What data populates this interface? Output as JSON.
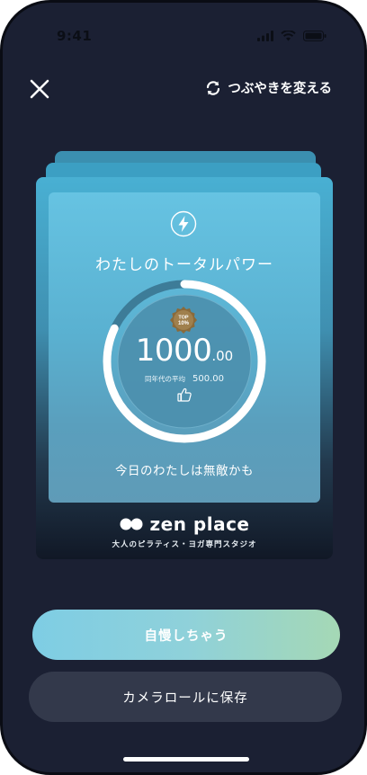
{
  "status_bar": {
    "time": "9:41"
  },
  "header": {
    "change_label": "つぶやきを変える"
  },
  "card": {
    "title": "わたしのトータルパワー",
    "badge": {
      "line1": "TOP",
      "line2": "10%"
    },
    "score_main": "1000",
    "score_decimal": ".00",
    "average_label": "同年代の平均",
    "average_value": "500.00",
    "tagline": "今日のわたしは無敵かも",
    "gauge_progress": 0.82,
    "brand_name": "zen place",
    "brand_subtitle": "大人のピラティス・ヨガ専門スタジオ"
  },
  "actions": {
    "share_label": "自慢しちゃう",
    "save_label": "カメラロールに保存"
  },
  "colors": {
    "background": "#1b2033",
    "card_top": "#49b0d3",
    "button_gradient_start": "#7ecde4",
    "button_gradient_end": "#a5d8b5",
    "badge": "#8a6a3a"
  },
  "icons": [
    "close-icon",
    "refresh-icon",
    "bolt-icon",
    "thumbs-up-icon",
    "signal-icon",
    "wifi-icon",
    "battery-icon",
    "zen-place-logo-icon"
  ]
}
